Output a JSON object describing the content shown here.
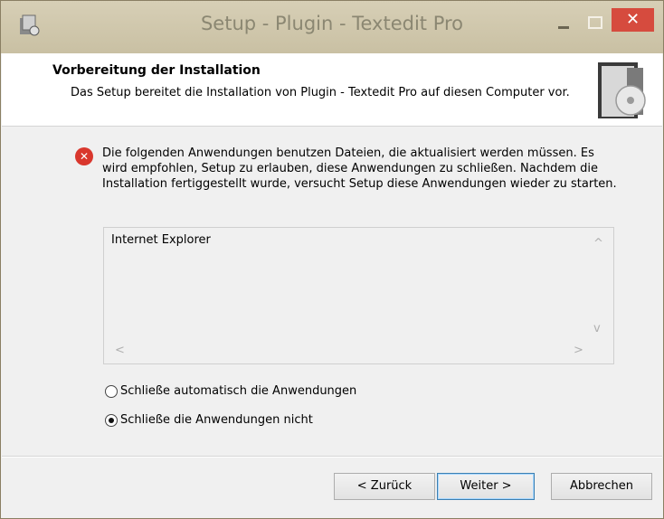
{
  "window": {
    "title": "Setup - Plugin - Textedit Pro",
    "close_glyph": "✕"
  },
  "header": {
    "title": "Vorbereitung der Installation",
    "description": "Das Setup bereitet die Installation von Plugin - Textedit Pro auf diesen Computer vor."
  },
  "content": {
    "error_glyph": "✕",
    "message": "Die folgenden Anwendungen benutzen Dateien, die aktualisiert werden müssen. Es wird empfohlen, Setup zu erlauben, diese Anwendungen zu schließen. Nachdem die Installation fertiggestellt wurde, versucht Setup diese Anwendungen wieder zu starten.",
    "applications": [
      "Internet Explorer"
    ],
    "scroll_glyphs": {
      "up": "^",
      "down": "v",
      "left": "<",
      "right": ">"
    },
    "options": [
      {
        "label": "Schließe automatisch die Anwendungen",
        "checked": false
      },
      {
        "label": "Schließe die Anwendungen nicht",
        "checked": true
      }
    ]
  },
  "buttons": {
    "back": "< Zurück",
    "next": "Weiter >",
    "cancel": "Abbrechen"
  },
  "colors": {
    "titlebar": "#cfc7ac",
    "close_button": "#d64b3e",
    "error_icon": "#d9372d"
  }
}
